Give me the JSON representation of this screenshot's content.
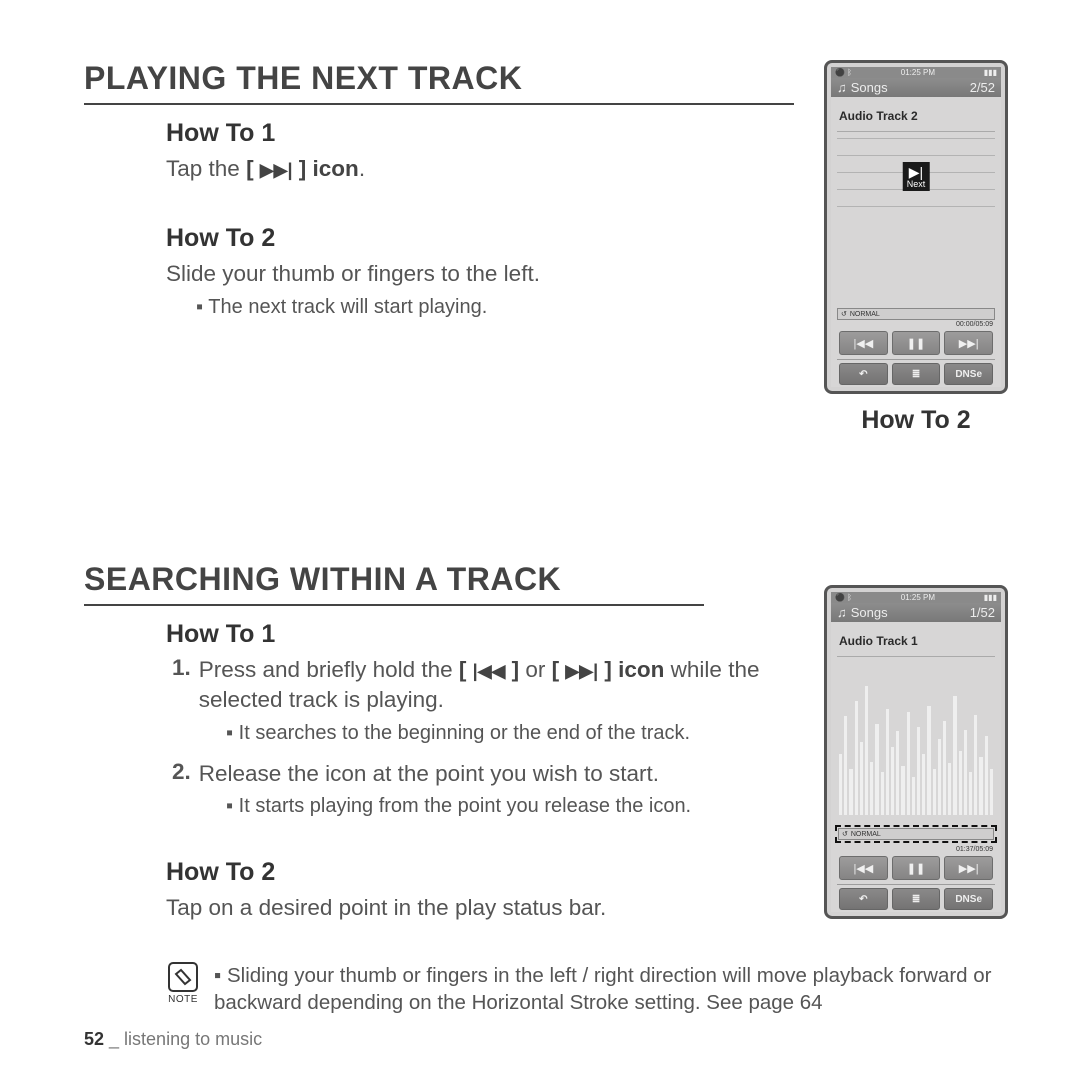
{
  "section1": {
    "title": "PLAYING THE NEXT TRACK",
    "how1_heading": "How To 1",
    "how1_text_pre": "Tap the ",
    "how1_text_bracket_open": "[ ",
    "how1_text_icon": "▶▶|",
    "how1_text_bracket_close": " ] ",
    "how1_text_post": "icon",
    "how1_text_period": ".",
    "how2_heading": "How To 2",
    "how2_text": "Slide your thumb or fingers to the left.",
    "how2_bullet": "The next track will start playing."
  },
  "phone1": {
    "time": "01:25 PM",
    "songs": "Songs",
    "counter": "2/52",
    "track": "Audio Track 2",
    "next_glyph": "▶|",
    "next_label": "Next",
    "normal": "NORMAL",
    "elapsed": "00:00/05:09",
    "prev": "|◀◀",
    "pause": "❚❚",
    "next": "▶▶|",
    "back": "↶",
    "menu": "≣",
    "dnse": "DNSe"
  },
  "side_how2": "How To 2",
  "section2": {
    "title": "SEARCHING WITHIN A TRACK",
    "how1_heading": "How To 1",
    "step1_num": "1.",
    "step1_pre": "Press and briefly hold the ",
    "step1_b_open1": "[ ",
    "step1_icon1": "|◀◀",
    "step1_b_close1": " ]",
    "step1_or": " or ",
    "step1_b_open2": "[ ",
    "step1_icon2": "▶▶|",
    "step1_b_close2": " ] ",
    "step1_iconword": "icon",
    "step1_post": " while the selected track is playing.",
    "step1_bullet": "It searches to the beginning or the end of the track.",
    "step2_num": "2.",
    "step2_text": "Release the icon at the point you wish to start.",
    "step2_bullet": "It starts playing from the point you release the icon.",
    "how2_heading": "How To 2",
    "how2_text": "Tap on a desired point in the play status bar."
  },
  "phone2": {
    "time": "01:25 PM",
    "songs": "Songs",
    "counter": "1/52",
    "track": "Audio Track 1",
    "normal": "NORMAL",
    "elapsed": "01:37/05:09",
    "prev": "|◀◀",
    "pause": "❚❚",
    "next": "▶▶|",
    "back": "↶",
    "menu": "≣",
    "dnse": "DNSe"
  },
  "note": {
    "label": "NOTE",
    "text": "Sliding your thumb or fingers in the left / right direction will move playback forward or backward depending on the Horizontal Stroke setting. See page 64"
  },
  "footer": {
    "page": "52",
    "sep": " _ ",
    "chapter": "listening to music"
  }
}
